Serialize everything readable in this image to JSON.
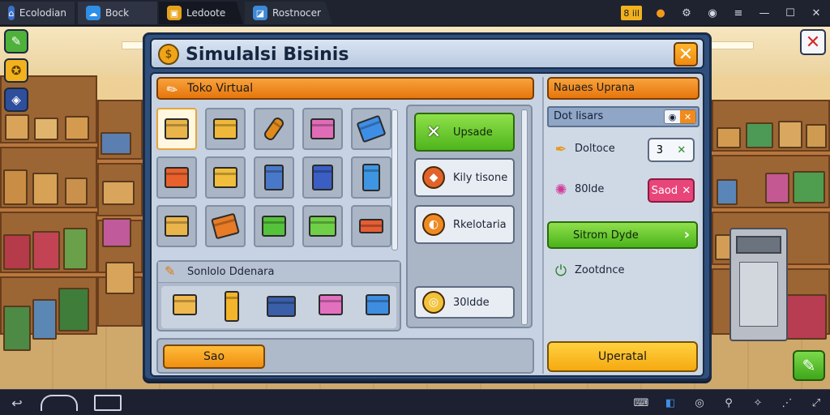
{
  "window": {
    "tabs": [
      {
        "label": "Ecolodian",
        "icon": "app-icon"
      },
      {
        "label": "Bock",
        "icon": "cloud-icon"
      },
      {
        "label": "Ledoote",
        "icon": "box-icon"
      },
      {
        "label": "Rostnocer",
        "icon": "image-icon"
      }
    ],
    "sys_labels": {
      "counter": "8 iil"
    }
  },
  "dialog": {
    "title": "Simulalsi Bisinis",
    "close_label": "✕",
    "left_panel": {
      "header": "Toko Virtual",
      "suggest_title": "Sonlolo Ddenara",
      "save_label": "Sao"
    },
    "actions": [
      {
        "label": "Upsade",
        "style": "green",
        "icon": "cross-icon"
      },
      {
        "label": "Kily tisone",
        "style": "plain",
        "icon": "orange-badge-icon"
      },
      {
        "label": "Rkelotaria",
        "style": "plain",
        "icon": "coin-icon"
      },
      {
        "label": "30ldde",
        "style": "plain",
        "icon": "ring-icon"
      }
    ],
    "right_panel": {
      "header": "Nauaes Uprana",
      "subheader": "Dot lisars",
      "stats": [
        {
          "label": "Doltoce",
          "value": "3",
          "icon": "quill-icon",
          "tone": "light"
        },
        {
          "label": "80lde",
          "value": "Saod",
          "icon": "compass-icon",
          "tone": "pink"
        }
      ],
      "green_button": "Sitrom Dyde",
      "footer_stat": "Zootdnce",
      "upgrade_label": "Uperatal"
    }
  },
  "colors": {
    "accent_orange": "#f08f10",
    "accent_green": "#4fb51c",
    "dialog_blue": "#2f4f7c",
    "pink_value": "#e8457a"
  }
}
